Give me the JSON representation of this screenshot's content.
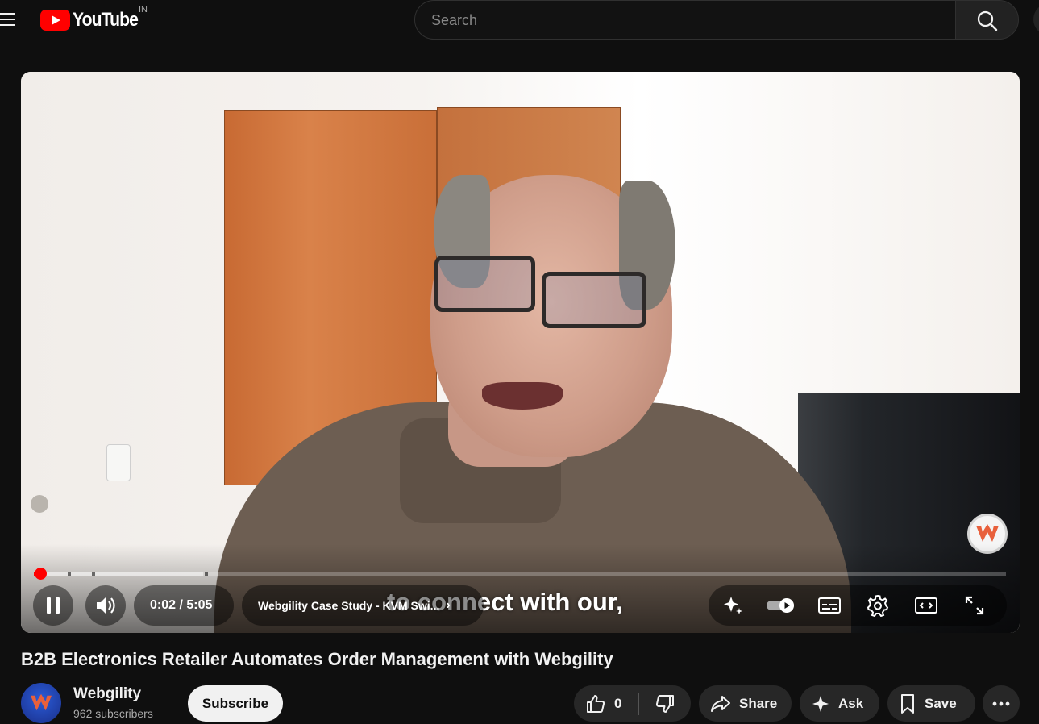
{
  "masthead": {
    "logo_text": "YouTube",
    "region": "IN",
    "search_placeholder": "Search",
    "search_value": ""
  },
  "player": {
    "current_time": "0:02",
    "duration": "5:05",
    "time_display": "0:02 / 5:05",
    "progress_fraction": 0.0066,
    "chapter_title": "Webgility Case Study - KVM Swi...",
    "caption": "to connect with our,",
    "autoplay_on": true
  },
  "video": {
    "title": "B2B Electronics Retailer Automates Order Management with Webgility",
    "channel_name": "Webgility",
    "subscribers": "962 subscribers",
    "subscribe_label": "Subscribe",
    "like_count": "0",
    "share_label": "Share",
    "ask_label": "Ask",
    "save_label": "Save"
  },
  "colors": {
    "background": "#0f0f0f",
    "brand_red": "#ff0000",
    "pill": "#272727",
    "text": "#f1f1f1"
  }
}
